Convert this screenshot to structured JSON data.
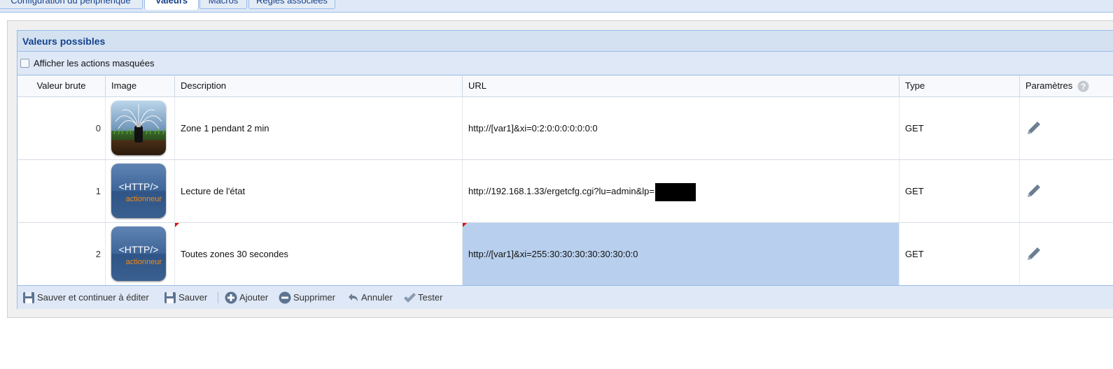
{
  "tabs": [
    {
      "label": "Configuration du périphérique",
      "active": false
    },
    {
      "label": "Valeurs",
      "active": true
    },
    {
      "label": "Macros",
      "active": false
    },
    {
      "label": "Règles associées",
      "active": false
    }
  ],
  "panel": {
    "title": "Valeurs possibles",
    "show_hidden_label": "Afficher les actions masquées",
    "show_hidden_checked": false
  },
  "columns": {
    "raw_value": "Valeur brute",
    "image": "Image",
    "description": "Description",
    "url": "URL",
    "type": "Type",
    "params": "Paramètres"
  },
  "rows": [
    {
      "raw": "0",
      "image_icon": "sprinkler-icon",
      "description": "Zone 1 pendant 2 min",
      "url": "http://[var1]&xi=0:2:0:0:0:0:0:0:0",
      "type": "GET"
    },
    {
      "raw": "1",
      "image_icon": "http-actionneur-icon",
      "image_text": "<HTTP/>",
      "image_sub": "actionneur",
      "description": "Lecture de l'état",
      "url": "http://192.168.1.33/ergetcfg.cgi?lu=admin&lp=",
      "type": "GET"
    },
    {
      "raw": "2",
      "image_icon": "http-actionneur-icon",
      "image_text": "<HTTP/>",
      "image_sub": "actionneur",
      "description": "Toutes zones 30 secondes",
      "url": "http://[var1]&xi=255:30:30:30:30:30:30:0:0",
      "type": "GET"
    }
  ],
  "toolbar": {
    "save_continue": "Sauver et continuer à éditer",
    "save": "Sauver",
    "add": "Ajouter",
    "delete": "Supprimer",
    "cancel": "Annuler",
    "test": "Tester"
  },
  "colors": {
    "header_blue": "#15428b",
    "border_blue": "#99bbe8",
    "selection": "#b8d0ed",
    "http_orange": "#f08a1a"
  }
}
